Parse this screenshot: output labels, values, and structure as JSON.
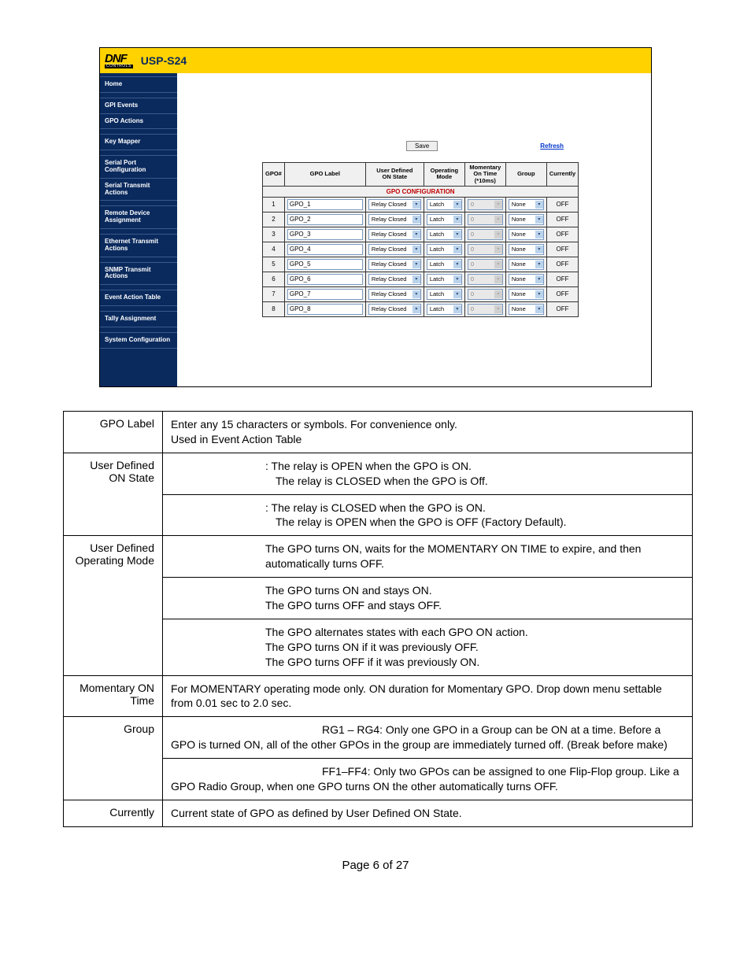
{
  "header": {
    "logo_main": "DNF",
    "logo_sub": "CONTROLS",
    "model": "USP-S24"
  },
  "sidebar": [
    {
      "label": "Home",
      "cls": "single"
    },
    {
      "label": "GPI Events",
      "cls": "group-first"
    },
    {
      "label": "GPO Actions",
      "cls": "single"
    },
    {
      "label": "Key Mapper",
      "cls": "group-first single"
    },
    {
      "label": "Serial Port Configuration",
      "cls": "group-first"
    },
    {
      "label": "Serial Transmit Actions",
      "cls": "single"
    },
    {
      "label": "Remote Device Assignment",
      "cls": "group-first single"
    },
    {
      "label": "Ethernet Transmit Actions",
      "cls": "group-first single"
    },
    {
      "label": "SNMP Transmit Actions",
      "cls": "group-first single"
    },
    {
      "label": "Event Action Table",
      "cls": "group-first single"
    },
    {
      "label": "Tally Assignment",
      "cls": "group-first single"
    },
    {
      "label": "System Configuration",
      "cls": "group-first single"
    }
  ],
  "controls": {
    "save": "Save",
    "refresh": "Refresh"
  },
  "gpo_table": {
    "title": "GPO CONFIGURATION",
    "columns": [
      "GPO#",
      "GPO Label",
      "User Defined ON State",
      "Operating Mode",
      "Momentary On Time (*10ms)",
      "Group",
      "Currently"
    ],
    "rows": [
      {
        "num": "1",
        "label": "GPO_1",
        "state": "Relay Closed",
        "mode": "Latch",
        "time": "0",
        "group": "None",
        "cur": "OFF"
      },
      {
        "num": "2",
        "label": "GPO_2",
        "state": "Relay Closed",
        "mode": "Latch",
        "time": "0",
        "group": "None",
        "cur": "OFF"
      },
      {
        "num": "3",
        "label": "GPO_3",
        "state": "Relay Closed",
        "mode": "Latch",
        "time": "0",
        "group": "None",
        "cur": "OFF"
      },
      {
        "num": "4",
        "label": "GPO_4",
        "state": "Relay Closed",
        "mode": "Latch",
        "time": "0",
        "group": "None",
        "cur": "OFF"
      },
      {
        "num": "5",
        "label": "GPO_5",
        "state": "Relay Closed",
        "mode": "Latch",
        "time": "0",
        "group": "None",
        "cur": "OFF"
      },
      {
        "num": "6",
        "label": "GPO_6",
        "state": "Relay Closed",
        "mode": "Latch",
        "time": "0",
        "group": "None",
        "cur": "OFF"
      },
      {
        "num": "7",
        "label": "GPO_7",
        "state": "Relay Closed",
        "mode": "Latch",
        "time": "0",
        "group": "None",
        "cur": "OFF"
      },
      {
        "num": "8",
        "label": "GPO_8",
        "state": "Relay Closed",
        "mode": "Latch",
        "time": "0",
        "group": "None",
        "cur": "OFF"
      }
    ]
  },
  "desc": {
    "gpo_label_title": "GPO Label",
    "gpo_label_body": "Enter any 15 characters or symbols.  For convenience only.\nUsed in Event Action Table",
    "on_state_title": "User Defined ON State",
    "on_state_1": ":  The relay is OPEN when the GPO is ON.",
    "on_state_2": "The relay is CLOSED when the GPO is Off.",
    "on_state_3": ":  The relay is CLOSED when the GPO is ON.",
    "on_state_4": "The relay is OPEN when the GPO is OFF (Factory Default).",
    "op_mode_title": "User Defined Operating Mode",
    "op_mode_1": "The GPO turns ON, waits for the MOMENTARY ON TIME to expire, and then automatically turns OFF.",
    "op_mode_2a": "The GPO turns ON and stays ON.",
    "op_mode_2b": "The GPO turns OFF and stays OFF.",
    "op_mode_3a": "The GPO alternates states with each GPO ON action.",
    "op_mode_3b": "The GPO turns ON if it was previously OFF.",
    "op_mode_3c": "The GPO turns OFF if it was previously ON.",
    "mom_title": "Momentary ON Time",
    "mom_body": "For MOMENTARY operating mode only.  ON duration for Momentary GPO.  Drop down menu settable from 0.01 sec to 2.0 sec.",
    "group_title": "Group",
    "group_1": "RG1 – RG4:  Only one GPO in a Group can be ON at a time.   Before a GPO is turned ON, all of the other GPOs in the group are immediately turned off.  (Break before make)",
    "group_2": "FF1–FF4:  Only two GPOs can be assigned to one Flip-Flop group.  Like a GPO Radio Group, when one GPO turns ON the other automatically turns OFF.",
    "currently_title": "Currently",
    "currently_body": "Current state of GPO as defined by User Defined ON State."
  },
  "page": "Page 6 of 27"
}
